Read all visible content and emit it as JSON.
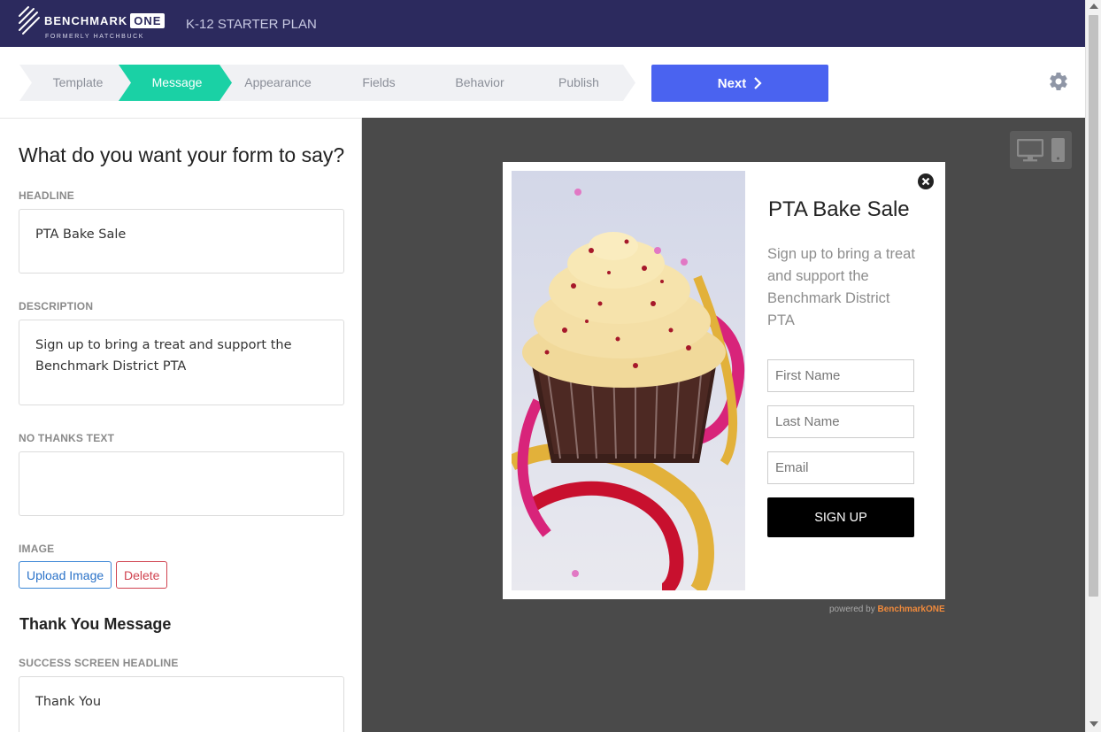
{
  "header": {
    "logo_text": "BENCHMARK",
    "logo_badge": "ONE",
    "logo_subtext": "FORMERLY HATCHBUCK",
    "plan_label": "K-12 STARTER PLAN"
  },
  "steps": [
    {
      "label": "Template",
      "active": false
    },
    {
      "label": "Message",
      "active": true
    },
    {
      "label": "Appearance",
      "active": false
    },
    {
      "label": "Fields",
      "active": false
    },
    {
      "label": "Behavior",
      "active": false
    },
    {
      "label": "Publish",
      "active": false
    }
  ],
  "next_button": {
    "label": "Next"
  },
  "editor": {
    "question": "What do you want your form to say?",
    "headline_label": "HEADLINE",
    "headline_value": "PTA Bake Sale",
    "description_label": "DESCRIPTION",
    "description_value": "Sign up to bring a treat and support the Benchmark District PTA",
    "no_thanks_label": "NO THANKS TEXT",
    "no_thanks_value": "",
    "image_label": "IMAGE",
    "upload_label": "Upload Image",
    "delete_label": "Delete",
    "thank_you_title": "Thank You Message",
    "success_headline_label": "SUCCESS SCREEN HEADLINE",
    "success_headline_value": "Thank You"
  },
  "popup": {
    "headline": "PTA Bake Sale",
    "description": "Sign up to bring a treat and support the Benchmark District PTA",
    "first_name_placeholder": "First Name",
    "last_name_placeholder": "Last Name",
    "email_placeholder": "Email",
    "signup_label": "SIGN UP",
    "powered_by": "powered by",
    "powered_brand": "BenchmarkONE"
  },
  "colors": {
    "nav_bg": "#2c2a5e",
    "active_step": "#1ad1a5",
    "inactive_step": "#f0f1f4",
    "next_button": "#4a63f0",
    "preview_bg": "#4a4a4a",
    "signup_button": "#000000",
    "brand_orange": "#f08a3c"
  },
  "icons": {
    "gear": "gear-icon",
    "close": "close-icon",
    "desktop": "desktop-icon",
    "mobile": "mobile-icon",
    "chevron": "chevron-right-icon"
  }
}
